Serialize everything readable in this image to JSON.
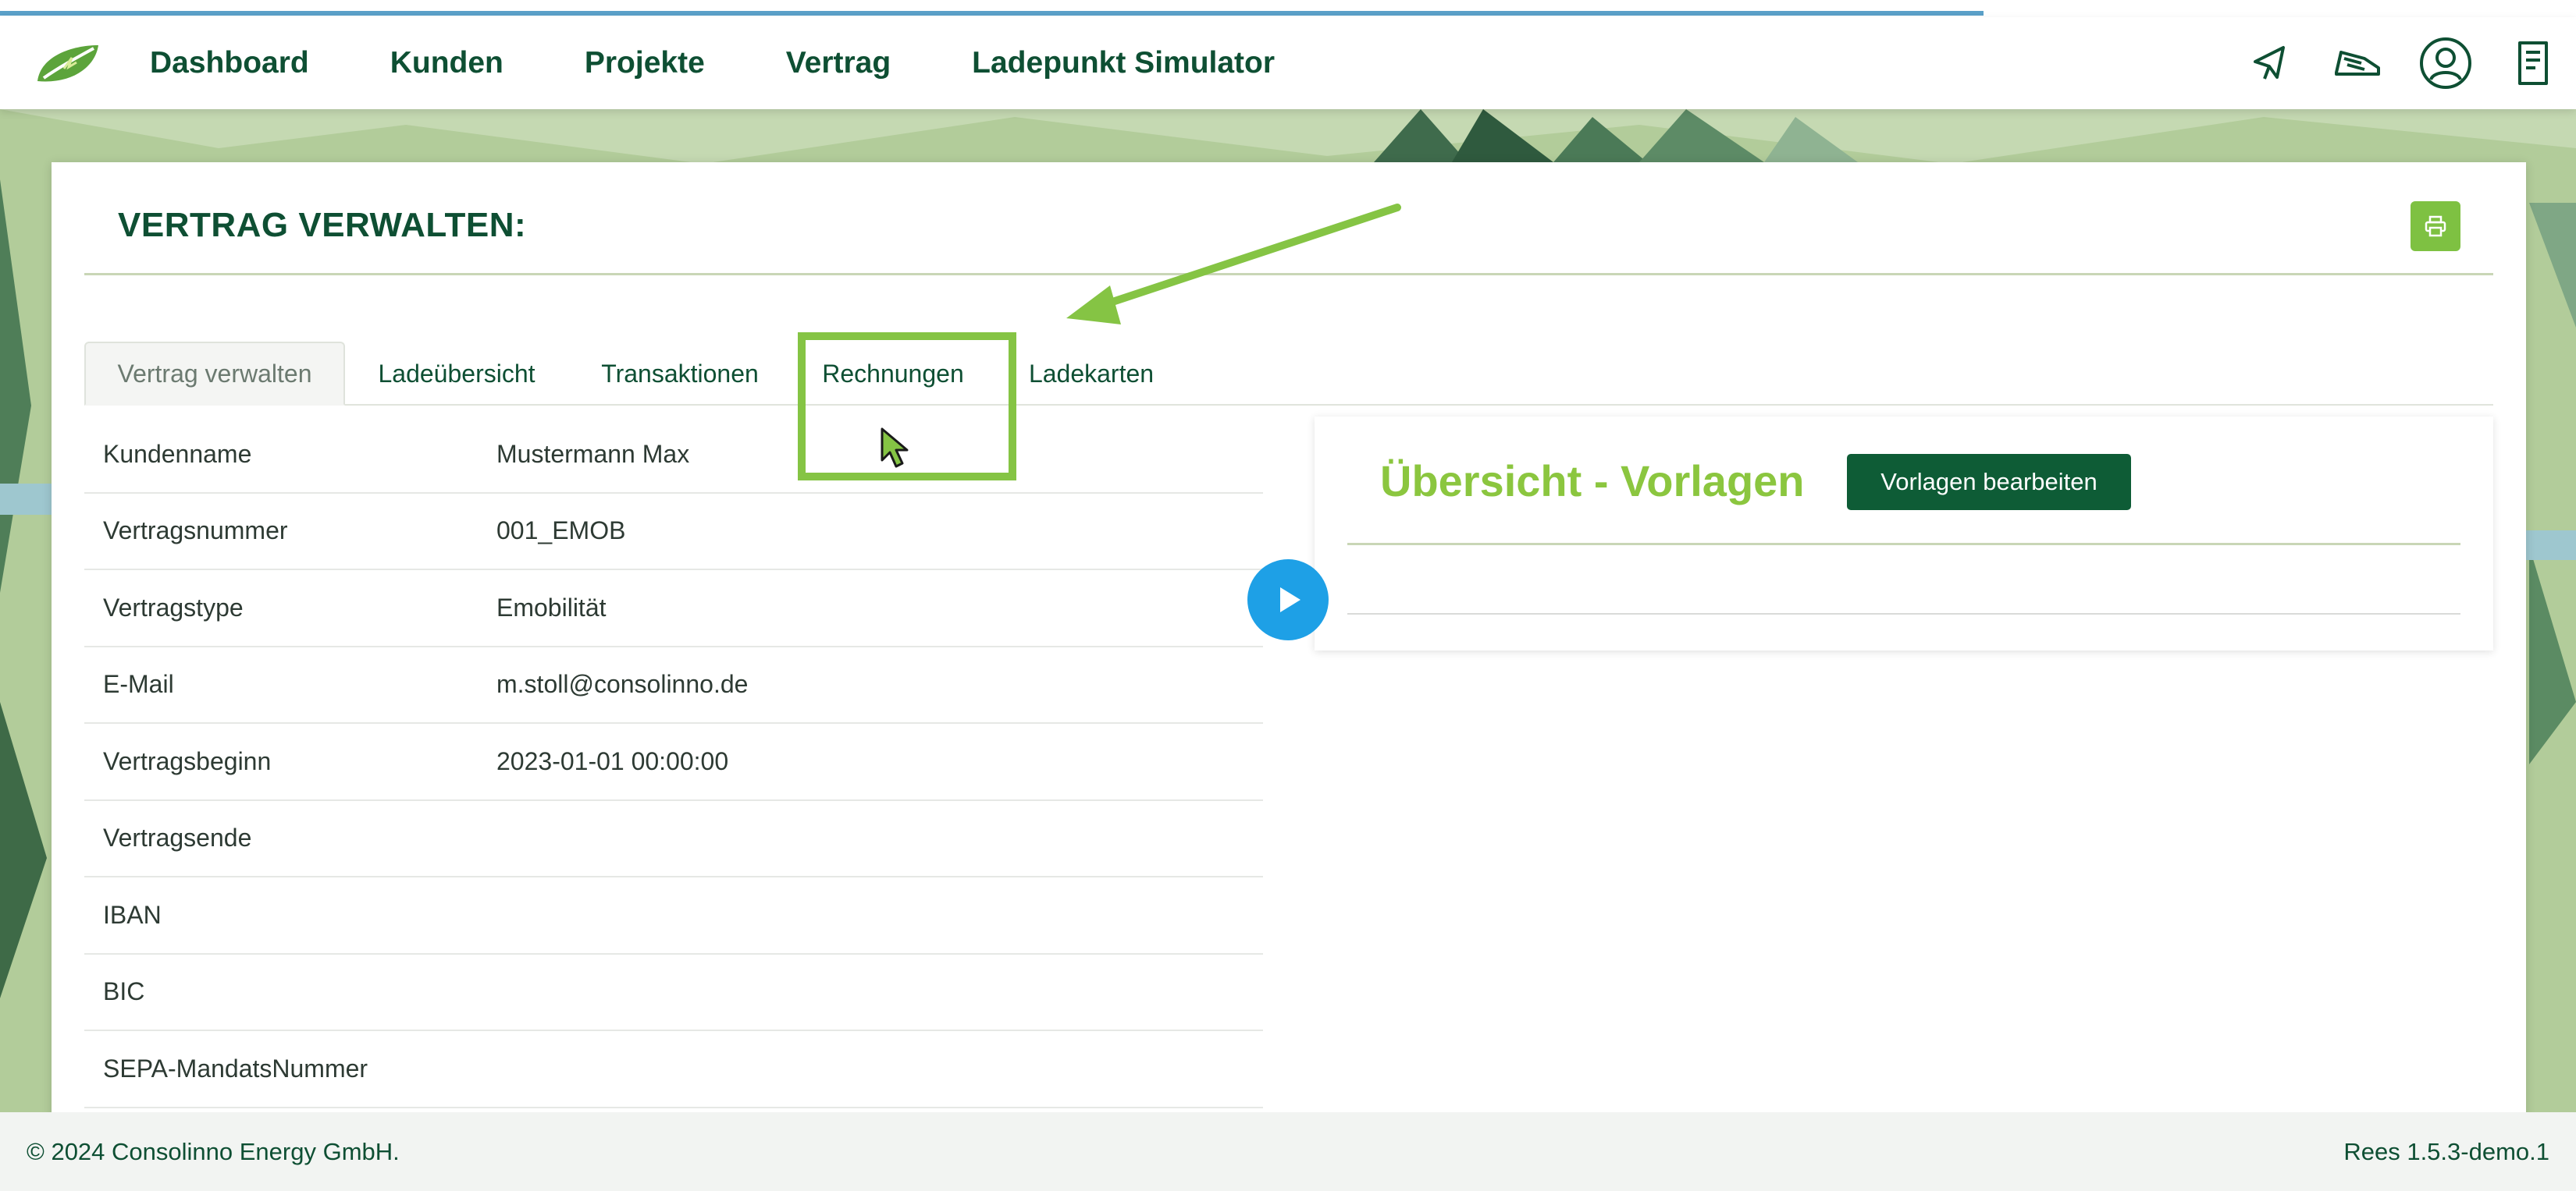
{
  "nav": {
    "links": [
      "Dashboard",
      "Kunden",
      "Projekte",
      "Vertrag",
      "Ladepunkt Simulator"
    ],
    "icons": [
      "pin-icon",
      "truck-icon",
      "user-icon",
      "document-icon"
    ]
  },
  "progress": {
    "fraction": 0.77
  },
  "page": {
    "title": "VERTRAG VERWALTEN:"
  },
  "tabs": [
    "Vertrag verwalten",
    "Ladeübersicht",
    "Transaktionen",
    "Rechnungen",
    "Ladekarten"
  ],
  "details": {
    "rows": [
      {
        "label": "Kundenname",
        "value": "Mustermann Max"
      },
      {
        "label": "Vertragsnummer",
        "value": "001_EMOB"
      },
      {
        "label": "Vertragstype",
        "value": "Emobilität"
      },
      {
        "label": "E-Mail",
        "value": "m.stoll@consolinno.de"
      },
      {
        "label": "Vertragsbeginn",
        "value": "2023-01-01 00:00:00"
      },
      {
        "label": "Vertragsende",
        "value": ""
      },
      {
        "label": "IBAN",
        "value": ""
      },
      {
        "label": "BIC",
        "value": ""
      },
      {
        "label": "SEPA-MandatsNummer",
        "value": ""
      }
    ]
  },
  "overview": {
    "title": "Übersicht - Vorlagen",
    "button": "Vorlagen bearbeiten"
  },
  "footer": {
    "copyright": "© 2024 Consolinno Energy GmbH.",
    "version": "Rees 1.5.3-demo.1"
  },
  "colors": {
    "brand_dark": "#0e4f33",
    "brand_green": "#8bc63f",
    "highlight": "#85c444",
    "play": "#1ea0e6"
  }
}
